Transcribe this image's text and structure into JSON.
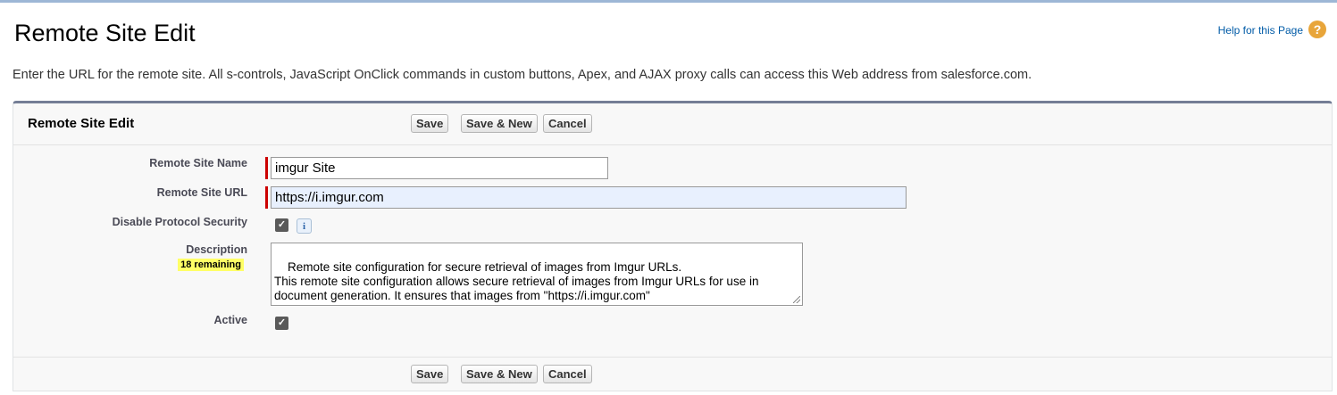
{
  "page": {
    "title": "Remote Site Edit",
    "help_link": "Help for this Page",
    "intro": "Enter the URL for the remote site. All s-controls, JavaScript OnClick commands in custom buttons, Apex, and AJAX proxy calls can access this Web address from salesforce.com."
  },
  "panel": {
    "title": "Remote Site Edit",
    "buttons": {
      "save": "Save",
      "save_new": "Save & New",
      "cancel": "Cancel"
    }
  },
  "form": {
    "remote_site_name": {
      "label": "Remote Site Name",
      "value": "imgur Site",
      "required": true
    },
    "remote_site_url": {
      "label": "Remote Site URL",
      "value": "https://i.imgur.com",
      "required": true
    },
    "disable_protocol_security": {
      "label": "Disable Protocol Security",
      "checked": true,
      "info_icon": "i"
    },
    "description": {
      "label": "Description",
      "remaining": "18 remaining",
      "value": "Remote site configuration for secure retrieval of images from Imgur URLs.\nThis remote site configuration allows secure retrieval of images from Imgur URLs for use in document generation. It ensures that images from \"https://i.imgur.com\""
    },
    "active": {
      "label": "Active",
      "checked": true
    }
  },
  "colors": {
    "accent_header_border": "#747e96",
    "required": "#cc0000",
    "help_icon": "#e8a53a",
    "link": "#015ba7",
    "url_field_bg": "#e8f0fe"
  },
  "icons": {
    "help": "question-circle-icon",
    "info": "info-icon",
    "checkbox": "checkmark-icon"
  }
}
